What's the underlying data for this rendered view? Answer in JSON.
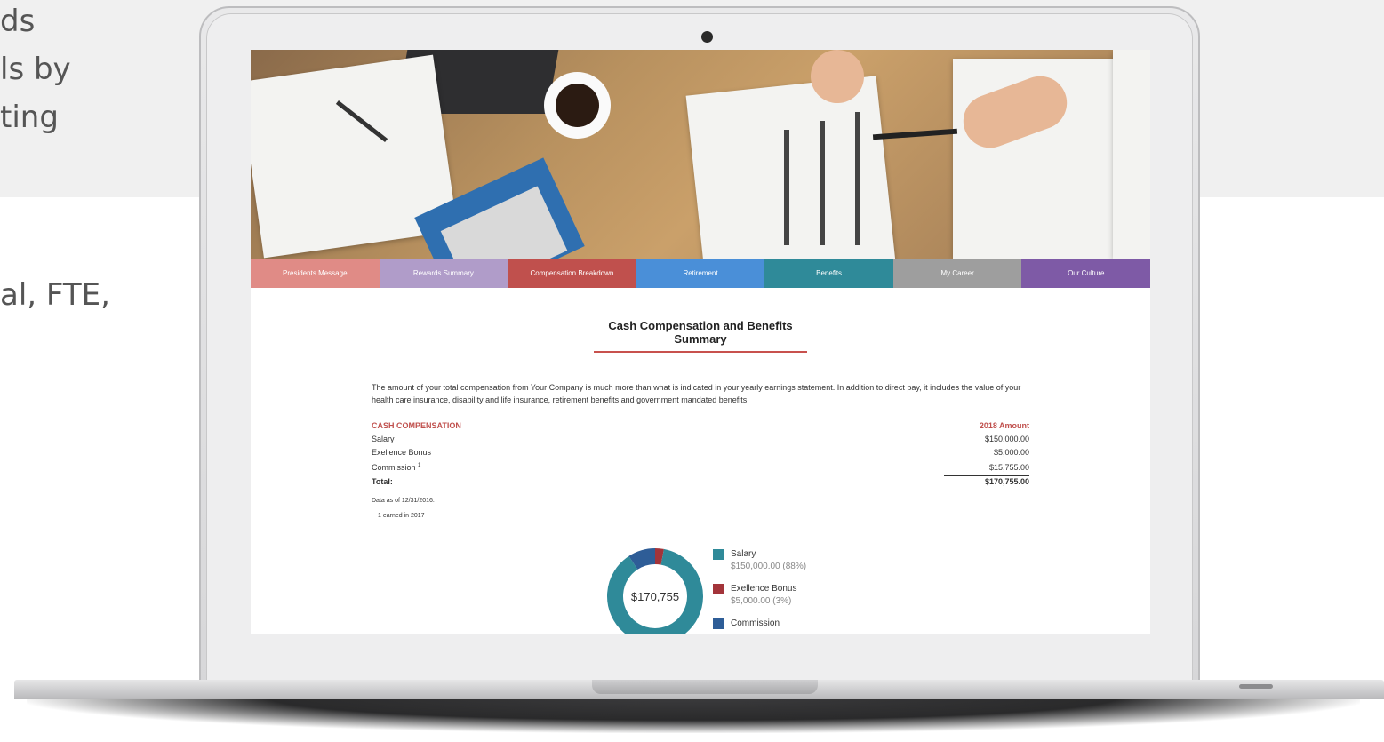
{
  "background": {
    "lines": [
      "ds",
      "ls by",
      "ting",
      "al, FTE,"
    ]
  },
  "nav": {
    "items": [
      {
        "label": "Presidents Message",
        "color": "#e08b86"
      },
      {
        "label": "Rewards Summary",
        "color": "#b09cc9"
      },
      {
        "label": "Compensation Breakdown",
        "color": "#c0504d"
      },
      {
        "label": "Retirement",
        "color": "#4a8fd8"
      },
      {
        "label": "Benefits",
        "color": "#2f8a99"
      },
      {
        "label": "My Career",
        "color": "#9e9e9e"
      },
      {
        "label": "Our Culture",
        "color": "#7e5aa6"
      }
    ]
  },
  "main": {
    "title_line1": "Cash Compensation and Benefits",
    "title_line2": "Summary",
    "intro": "The amount of your total compensation from Your Company is much more than what is indicated in your yearly earnings statement. In addition to direct pay, it includes the value of your health care insurance, disability and life insurance, retirement benefits and government mandated benefits.",
    "table": {
      "header_label": "CASH COMPENSATION",
      "header_amount": "2018 Amount",
      "rows": [
        {
          "label": "Salary",
          "amount": "$150,000.00"
        },
        {
          "label": "Exellence Bonus",
          "amount": "$5,000.00"
        },
        {
          "label": "Commission",
          "sup": "1",
          "amount": "$15,755.00"
        }
      ],
      "total_label": "Total:",
      "total_amount": "$170,755.00"
    },
    "note1": "Data as of 12/31/2016.",
    "note2": "1  earned in 2017"
  },
  "chart_data": {
    "type": "pie",
    "center_label": "$170,755",
    "series": [
      {
        "name": "Salary",
        "value": 150000,
        "display": "$150,000.00 (88%)",
        "color": "#2f8a99"
      },
      {
        "name": "Exellence Bonus",
        "value": 5000,
        "display": "$5,000.00 (3%)",
        "color": "#a3343a"
      },
      {
        "name": "Commission",
        "value": 15755,
        "display": "",
        "color": "#2e5d97"
      }
    ]
  }
}
